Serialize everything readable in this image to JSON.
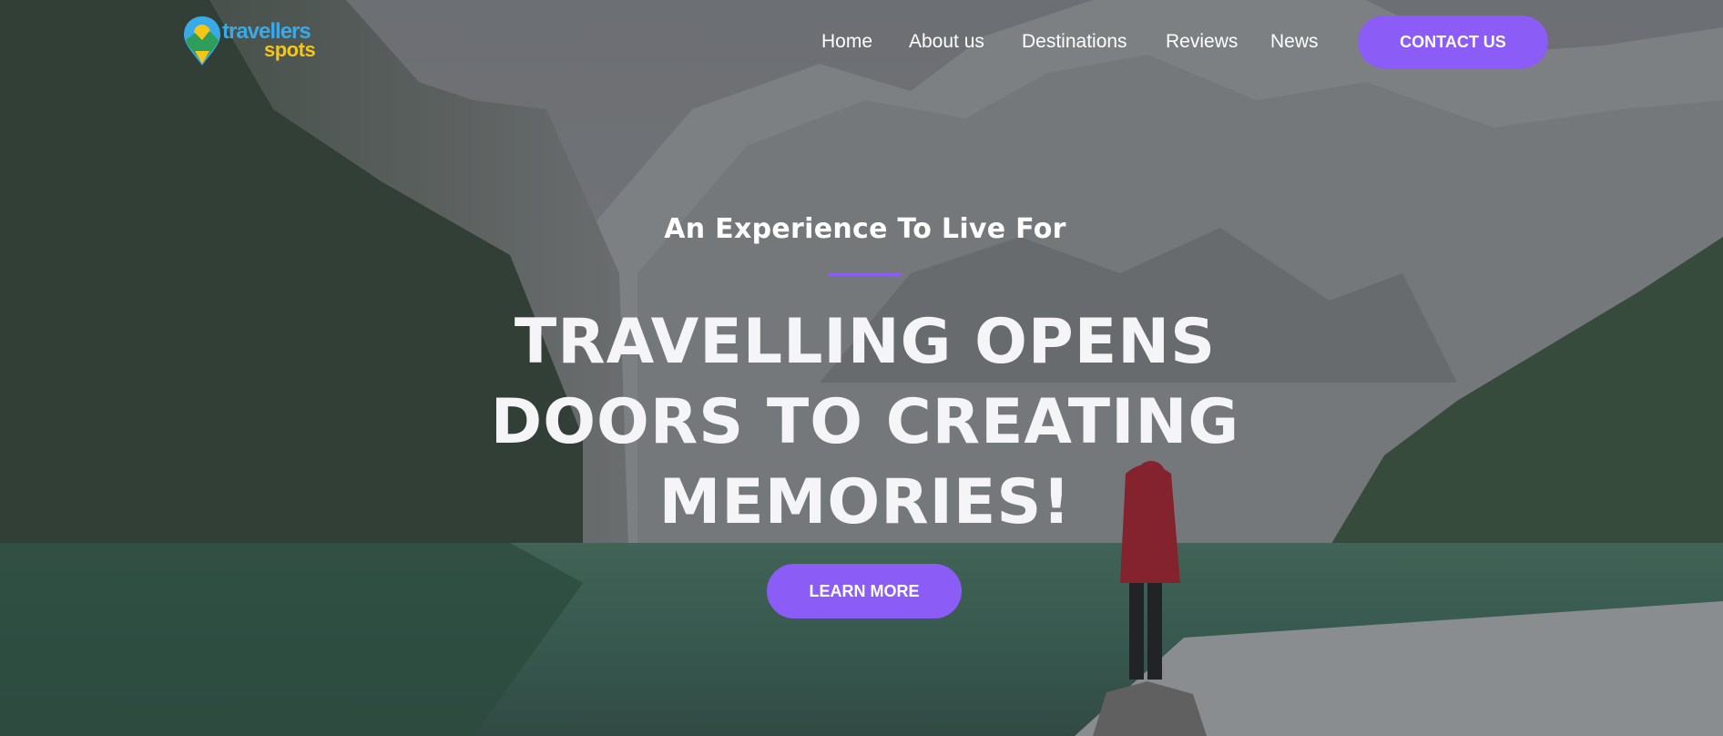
{
  "brand": {
    "line1": "travellers",
    "line2": "spots"
  },
  "nav": {
    "items": [
      "Home",
      "About us",
      "Destinations",
      "Reviews",
      "News"
    ],
    "cta_label": "CONTACT US"
  },
  "hero": {
    "tagline": "An Experience To Live For",
    "headline_line1": "TRAVELLING OPENS",
    "headline_line2": "DOORS TO CREATING",
    "headline_line3": "MEMORIES!",
    "cta_label": "LEARN MORE"
  },
  "colors": {
    "accent": "#8b5cf6",
    "text": "#ffffff",
    "logo_blue": "#3aa9e8",
    "logo_yellow": "#f5c518"
  },
  "icons": {
    "logo": "map-pin-logo-icon"
  }
}
